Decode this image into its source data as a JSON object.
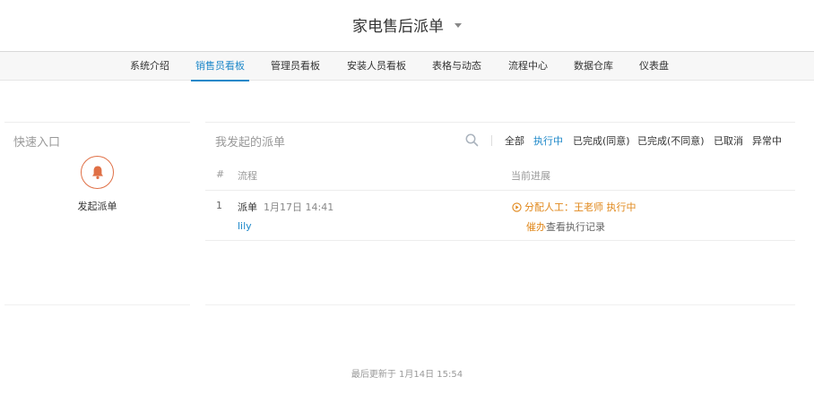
{
  "header": {
    "title": "家电售后派单"
  },
  "nav": {
    "tabs": [
      {
        "label": "系统介绍"
      },
      {
        "label": "销售员看板"
      },
      {
        "label": "管理员看板"
      },
      {
        "label": "安装人员看板"
      },
      {
        "label": "表格与动态"
      },
      {
        "label": "流程中心"
      },
      {
        "label": "数据仓库"
      },
      {
        "label": "仪表盘"
      }
    ],
    "active": "销售员看板"
  },
  "quick_entry": {
    "title": "快速入口",
    "button_icon": "bell-icon",
    "button_label": "发起派单"
  },
  "orders": {
    "title": "我发起的派单",
    "search_icon": "search-icon",
    "filters": [
      "全部",
      "执行中",
      "已完成(同意)",
      "已完成(不同意)",
      "已取消",
      "异常中"
    ],
    "active_filter": "执行中",
    "columns": {
      "index": "#",
      "flow": "流程",
      "progress": "当前进展"
    },
    "rows": [
      {
        "index": "1",
        "flow_name": "派单",
        "time": "1月17日 14:41",
        "user": "lily",
        "progress": "分配人工：王老师 执行中",
        "urge": "催办",
        "history": "查看执行记录"
      }
    ]
  },
  "footer": {
    "updated": "最后更新于 1月14日 15:54"
  },
  "colors": {
    "accent": "#1e88c9",
    "warning": "#e0871a",
    "bell": "#e07046"
  }
}
